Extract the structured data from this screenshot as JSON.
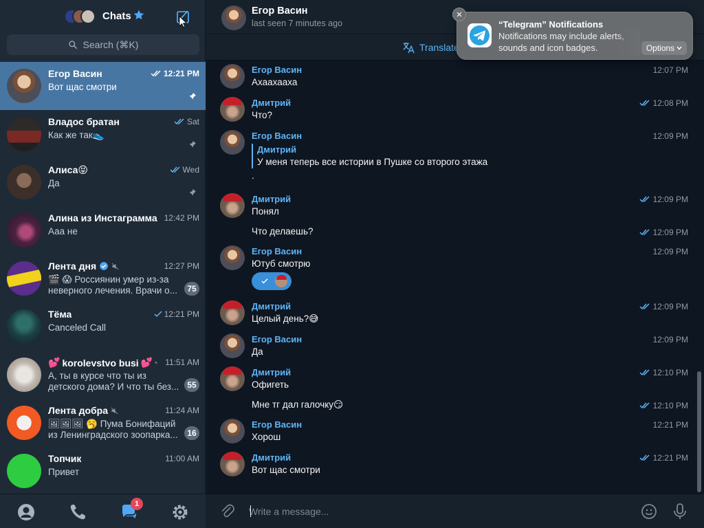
{
  "sidebar": {
    "title": "Chats",
    "search_placeholder": "Search (⌘K)",
    "chats": [
      {
        "name": "Егор Васин",
        "time": "12:21 PM",
        "preview": "Вот щас смотри",
        "read": true,
        "pinned": true,
        "active": true
      },
      {
        "name": "Владос братан",
        "time": "Sat",
        "preview": "Как же так",
        "preview_emoji": "👟",
        "read": true,
        "pinned": true
      },
      {
        "name": "Алиса",
        "name_emoji": "😝",
        "time": "Wed",
        "preview": "Да",
        "read": true,
        "pinned": true
      },
      {
        "name": "Алина из Инстаграмма",
        "time": "12:42 PM",
        "preview": "Ааа не"
      },
      {
        "name": "Лента дня",
        "verified": true,
        "muted": true,
        "time": "12:27 PM",
        "preview_emoji": "🎬 😱",
        "preview": "Россиянин умер из-за неверного лечения. Врачи о...",
        "badge": "75"
      },
      {
        "name": "Тёма",
        "time": "12:21 PM",
        "preview": "Canceled Call",
        "read_single": true
      },
      {
        "name": "korolevstvo busi",
        "name_emoji_left": "💕",
        "name_emoji_right": "💕",
        "muted": true,
        "time": "11:51 AM",
        "preview": "А, ты в курсе что ты из детского дома? И что ты без...",
        "badge": "55"
      },
      {
        "name": "Лента добра",
        "muted": true,
        "time": "11:24 AM",
        "preview_emoji": "🖼🖼🖼 🥱",
        "preview": "Пума Бонифаций из Ленинградского зоопарка...",
        "badge": "16"
      },
      {
        "name": "Топчик",
        "time": "11:00 AM",
        "preview": "Привет"
      }
    ],
    "tabs": [
      "contacts-icon",
      "calls-icon",
      "chats-icon",
      "settings-icon"
    ],
    "chats_tab_badge": "1"
  },
  "chat": {
    "name": "Егор Васин",
    "status": "last seen 7 minutes ago",
    "translate_label": "Translate"
  },
  "messages": [
    {
      "author": "Егор Васин",
      "text": "Ахаахааха",
      "time": "12:07 PM"
    },
    {
      "author": "Дмитрий",
      "text": "Что?",
      "time": "12:08 PM",
      "read": true
    },
    {
      "author": "Егор Васин",
      "reply_author": "Дмитрий",
      "reply_text": "У меня теперь все истории в Пушке со второго этажа",
      "text": ".",
      "time": "12:09 PM"
    },
    {
      "author": "Дмитрий",
      "text": "Понял",
      "time": "12:09 PM",
      "read": true
    },
    {
      "text": "Что делаешь?",
      "time": "12:09 PM",
      "read": true
    },
    {
      "author": "Егор Васин",
      "text": "Ютуб смотрю",
      "time": "12:09 PM"
    },
    {
      "author": "Дмитрий",
      "text": "Целый день?😅",
      "time": "12:09 PM",
      "read": true
    },
    {
      "author": "Егор Васин",
      "text": "Да",
      "time": "12:09 PM"
    },
    {
      "author": "Дмитрий",
      "text": "Офигеть",
      "time": "12:10 PM",
      "read": true
    },
    {
      "text": "Мне тг дал галочку😏",
      "time": "12:10 PM",
      "read": true
    },
    {
      "author": "Егор Васин",
      "text": "Хорош",
      "time": "12:21 PM"
    },
    {
      "author": "Дмитрий",
      "text": "Вот щас смотри",
      "time": "12:21 PM",
      "read": true
    }
  ],
  "composer": {
    "placeholder": "Write a message..."
  },
  "notification": {
    "title": "“Telegram” Notifications",
    "body": "Notifications may include alerts, sounds and icon badges.",
    "options_label": "Options"
  },
  "colors": {
    "sidebar_bg": "#1f2a37",
    "active_chat": "#4876a3",
    "chat_bg": "#0e1621",
    "accent": "#5eb5f7",
    "badge": "#5e6b78",
    "unread_red": "#e2475a"
  }
}
